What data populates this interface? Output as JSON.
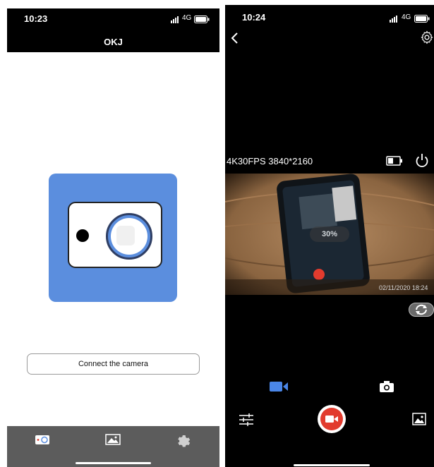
{
  "left_screen": {
    "status": {
      "time": "10:23",
      "network": "4G"
    },
    "header": {
      "title": "OKJ"
    },
    "connect_label": "Connect the camera",
    "tabs": [
      {
        "icon": "camera-tab-icon"
      },
      {
        "icon": "gallery-tab-icon"
      },
      {
        "icon": "settings-tab-icon"
      }
    ],
    "colors": {
      "accent": "#5b8ede",
      "tabbar": "#5c5c5c"
    }
  },
  "right_screen": {
    "status": {
      "time": "10:24",
      "network": "4G"
    },
    "resolution": "4K30FPS 3840*2160",
    "preview": {
      "percent": "30%",
      "timestamp": "02/11/2020 18:24"
    },
    "modes": [
      {
        "icon": "video-mode-icon",
        "active": true
      },
      {
        "icon": "photo-mode-icon",
        "active": false
      }
    ],
    "colors": {
      "accent": "#4a86e8",
      "record": "#e23b2e"
    }
  }
}
